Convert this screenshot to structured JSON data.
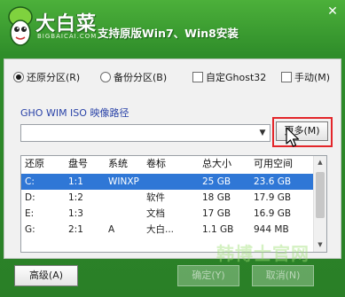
{
  "header": {
    "logo_text": "大白菜",
    "logo_subtext": "BIGBAICAI.COM",
    "tagline": "支持原版Win7、Win8安装",
    "close_glyph": "✕"
  },
  "options": {
    "restore_partition": {
      "label": "还原分区(R)",
      "checked": true
    },
    "backup_partition": {
      "label": "备份分区(B)",
      "checked": false
    },
    "custom_ghost32": {
      "label": "自定Ghost32",
      "checked": false
    },
    "manual": {
      "label": "手动(M)",
      "checked": false
    }
  },
  "path": {
    "label": "GHO WIM ISO 映像路径",
    "value": "",
    "dropdown_glyph": "▼",
    "more_button": "更多(M)"
  },
  "table": {
    "headers": [
      "还原",
      "盘号",
      "系统",
      "卷标",
      "总大小",
      "可用空间"
    ],
    "rows": [
      {
        "restore": "C:",
        "disk": "1:1",
        "system": "WINXP",
        "label": "",
        "total": "25 GB",
        "free": "23.6 GB",
        "selected": true
      },
      {
        "restore": "D:",
        "disk": "1:2",
        "system": "",
        "label": "软件",
        "total": "18 GB",
        "free": "17.9 GB",
        "selected": false
      },
      {
        "restore": "E:",
        "disk": "1:3",
        "system": "",
        "label": "文档",
        "total": "17 GB",
        "free": "16.9 GB",
        "selected": false
      },
      {
        "restore": "G:",
        "disk": "2:1",
        "system": "A",
        "label": "大白...",
        "total": "1.1 GB",
        "free": "944 MB",
        "selected": false
      }
    ],
    "scroll_up_glyph": "▲",
    "scroll_down_glyph": "▼"
  },
  "footer": {
    "advanced_button": "高级(A)",
    "ok_button": "确定(Y)",
    "cancel_button": "取消(N)",
    "watermark": "韩博士官网"
  },
  "colors": {
    "header_green": "#4cb03a",
    "body_green": "#2f8d2a",
    "selection_blue": "#2f77d6",
    "highlight_red": "#e3262a",
    "path_label_blue": "#2a43a8"
  },
  "icons": [
    "mascot-logo-icon",
    "close-icon",
    "dropdown-arrow-icon",
    "mouse-cursor-icon",
    "scroll-up-icon",
    "scroll-down-icon"
  ]
}
